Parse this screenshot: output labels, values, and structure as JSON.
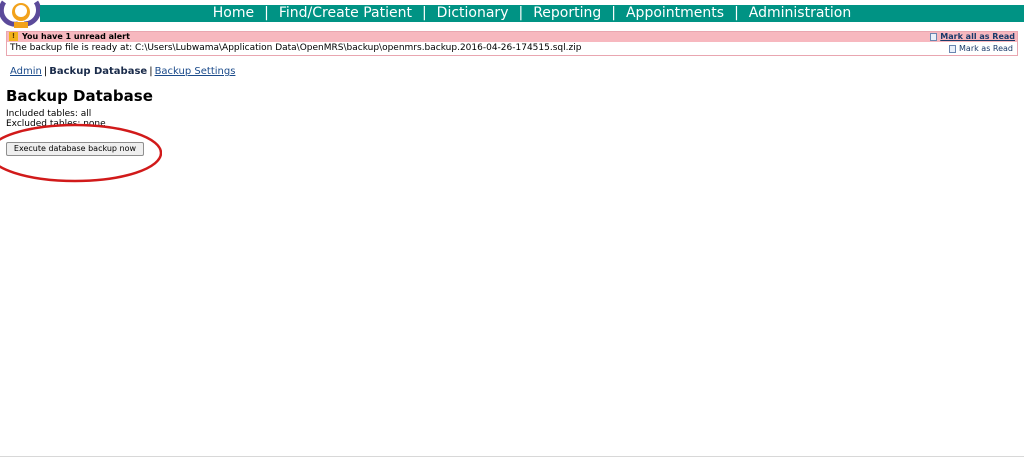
{
  "colors": {
    "nav_bg": "#009384",
    "alert_header_bg": "#f7b8bf",
    "link": "#1a4a8a",
    "annotation": "#d11a1a"
  },
  "nav": {
    "items": [
      {
        "label": "Home"
      },
      {
        "label": "Find/Create Patient"
      },
      {
        "label": "Dictionary"
      },
      {
        "label": "Reporting"
      },
      {
        "label": "Appointments"
      },
      {
        "label": "Administration"
      }
    ]
  },
  "alerts": {
    "header": "You have 1 unread alert",
    "mark_all_label": "Mark all as Read",
    "items": [
      {
        "text": "The backup file is ready at: C:\\Users\\Lubwama\\Application Data\\OpenMRS\\backup\\openmrs.backup.2016-04-26-174515.sql.zip",
        "mark_label": "Mark as Read"
      }
    ]
  },
  "breadcrumb": {
    "admin": "Admin",
    "current": "Backup Database",
    "settings": "Backup Settings"
  },
  "page": {
    "title": "Backup Database",
    "included": "Included tables: all",
    "excluded": "Excluded tables: none",
    "execute_button": "Execute database backup now"
  }
}
